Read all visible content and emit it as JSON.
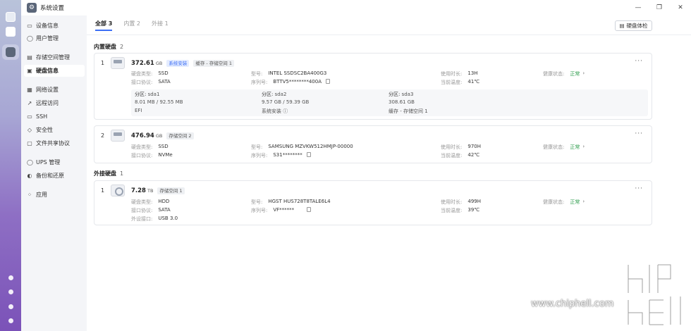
{
  "window": {
    "title": "系统设置"
  },
  "dock": {
    "items": [
      "monitor-icon",
      "apps-icon",
      "settings-icon"
    ],
    "bottom_items": [
      "info-icon",
      "bell-icon",
      "user-icon",
      "gear-icon"
    ]
  },
  "sidebar": {
    "items": [
      {
        "label": "设备信息",
        "icon": "monitor-icon"
      },
      {
        "label": "用户管理",
        "icon": "user-icon"
      },
      {
        "label": "存储空间管理",
        "icon": "storage-icon"
      },
      {
        "label": "硬盘信息",
        "icon": "disk-icon",
        "active": true
      },
      {
        "label": "网络设置",
        "icon": "network-icon"
      },
      {
        "label": "远程访问",
        "icon": "remote-icon"
      },
      {
        "label": "SSH",
        "icon": "terminal-icon"
      },
      {
        "label": "安全性",
        "icon": "shield-icon"
      },
      {
        "label": "文件共享协议",
        "icon": "share-icon"
      },
      {
        "label": "UPS 管理",
        "icon": "ups-icon"
      },
      {
        "label": "备份和还原",
        "icon": "backup-icon"
      },
      {
        "label": "应用",
        "icon": "apps-icon"
      }
    ]
  },
  "tabs": [
    {
      "label": "全部",
      "count": "3",
      "active": true
    },
    {
      "label": "内置",
      "count": "2"
    },
    {
      "label": "外接",
      "count": "1"
    }
  ],
  "bench_button": "硬盘体检",
  "labels": {
    "disk_type": "硬盘类型:",
    "interface": "接口协议:",
    "external_interface": "外设接口:",
    "model": "型号:",
    "serial": "序列号:",
    "power_on": "使用时长:",
    "temp": "当前温度:",
    "health": "健康状态:",
    "partition": "分区:"
  },
  "sections": {
    "internal": {
      "title": "内置硬盘",
      "count": "2"
    },
    "external": {
      "title": "外接硬盘",
      "count": "1"
    }
  },
  "disks": [
    {
      "index": "1",
      "capacity": "372.61",
      "unit": "GB",
      "badges": [
        "系统安装",
        "缓存 - 存储空间 1"
      ],
      "type": "SSD",
      "interface": "SATA",
      "model": "INTEL SSDSC2BA400G3",
      "serial": "BTTV5********400A",
      "power_on": "13H",
      "temp": "41℃",
      "health": "正常",
      "partitions": [
        {
          "name": "sda1",
          "size": "8.01 MB / 92.55 MB",
          "usage": "EFI"
        },
        {
          "name": "sda2",
          "size": "9.57 GB / 59.39 GB",
          "usage": "系统安装"
        },
        {
          "name": "sda3",
          "size": "308.61 GB",
          "usage": "缓存 - 存储空间 1"
        }
      ]
    },
    {
      "index": "2",
      "capacity": "476.94",
      "unit": "GB",
      "badges": [
        "存储空间 2"
      ],
      "type": "SSD",
      "interface": "NVMe",
      "model": "SAMSUNG MZVKW512HMJP-00000",
      "serial": "S31********",
      "power_on": "970H",
      "temp": "42℃",
      "health": "正常"
    },
    {
      "index": "1",
      "capacity": "7.28",
      "unit": "TB",
      "badges": [
        "存储空间 1"
      ],
      "type": "HDD",
      "interface": "SATA",
      "external_interface": "USB 3.0",
      "model": "HGST HUS728T8TALE6L4",
      "serial": "VF******",
      "power_on": "499H",
      "temp": "39℃",
      "health": "正常"
    }
  ],
  "watermark": {
    "text": "www.chiphell.com"
  },
  "colors": {
    "accent": "#3b6ef5",
    "health_ok": "#2e9d4d"
  }
}
